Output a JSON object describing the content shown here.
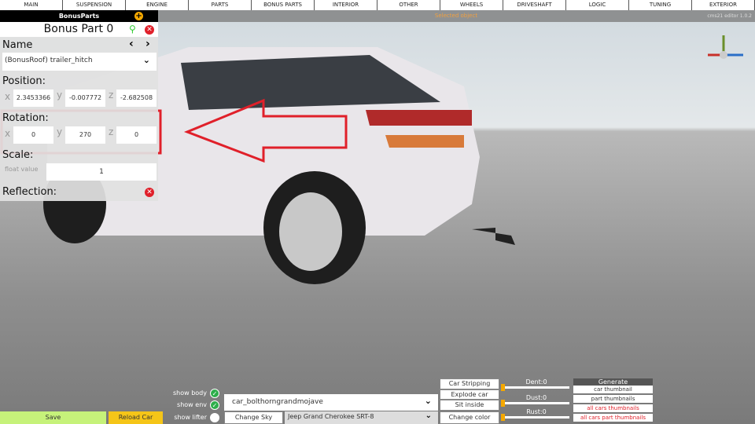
{
  "top_menu": [
    "MAIN",
    "SUSPENSION",
    "ENGINE",
    "PARTS",
    "BONUS PARTS",
    "INTERIOR",
    "OTHER",
    "WHEELS",
    "DRIVESHAFT",
    "LOGIC",
    "TUNING",
    "EXTERIOR"
  ],
  "subbar": {
    "section": "BonusParts",
    "status": "Selected object",
    "version": "cms21 editor 1.0.2"
  },
  "panel": {
    "title": "Bonus Part 0",
    "name_label": "Name",
    "name_value": "(BonusRoof) trailer_hitch",
    "position_label": "Position:",
    "position": {
      "x": "2.3453366",
      "y": "-0.007772",
      "z": "-2.682508"
    },
    "rotation_label": "Rotation:",
    "rotation": {
      "x": "0",
      "y": "270",
      "z": "0"
    },
    "scale_label": "Scale:",
    "scale_sub": "float value",
    "scale_value": "1",
    "reflection_label": "Reflection:",
    "axes": {
      "x": "x",
      "y": "y",
      "z": "z"
    }
  },
  "bottom": {
    "save": "Save",
    "reload": "Reload Car",
    "show_body": "show body",
    "show_env": "show env",
    "show_lifter": "show lifter",
    "show_body_on": true,
    "show_env_on": true,
    "show_lifter_on": false,
    "car_select": "car_bolthorngrandmojave",
    "change_sky": "Change Sky",
    "model_select": "Jeep Grand Cherokee SRT-8",
    "actions": [
      "Car Stripping",
      "Explode car",
      "Sit inside",
      "Change color"
    ],
    "sliders": [
      {
        "label": "Dent:0",
        "value": 0
      },
      {
        "label": "Dust:0",
        "value": 0
      },
      {
        "label": "Rust:0",
        "value": 0
      }
    ],
    "generate_title": "Generate",
    "generate": [
      "car thumbnail",
      "part thumbnails",
      "all cars thumbnails",
      "all cars part thumbnails"
    ]
  },
  "colors": {
    "accent": "#f5a800",
    "highlight": "#e0202a",
    "save": "#c6f27a",
    "reload": "#f5c518"
  }
}
